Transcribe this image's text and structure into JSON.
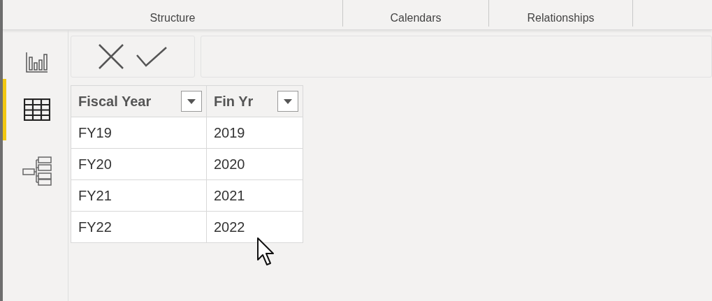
{
  "ribbon": {
    "groups": [
      {
        "label": "Structure"
      },
      {
        "label": "Calendars"
      },
      {
        "label": "Relationships"
      }
    ]
  },
  "sidebar": {
    "items": [
      {
        "kind": "report",
        "selected": false
      },
      {
        "kind": "data",
        "selected": true
      },
      {
        "kind": "model",
        "selected": false
      }
    ]
  },
  "table": {
    "columns": [
      "Fiscal Year",
      "Fin Yr"
    ],
    "rows": [
      [
        "FY19",
        "2019"
      ],
      [
        "FY20",
        "2020"
      ],
      [
        "FY21",
        "2021"
      ],
      [
        "FY22",
        "2022"
      ]
    ]
  }
}
